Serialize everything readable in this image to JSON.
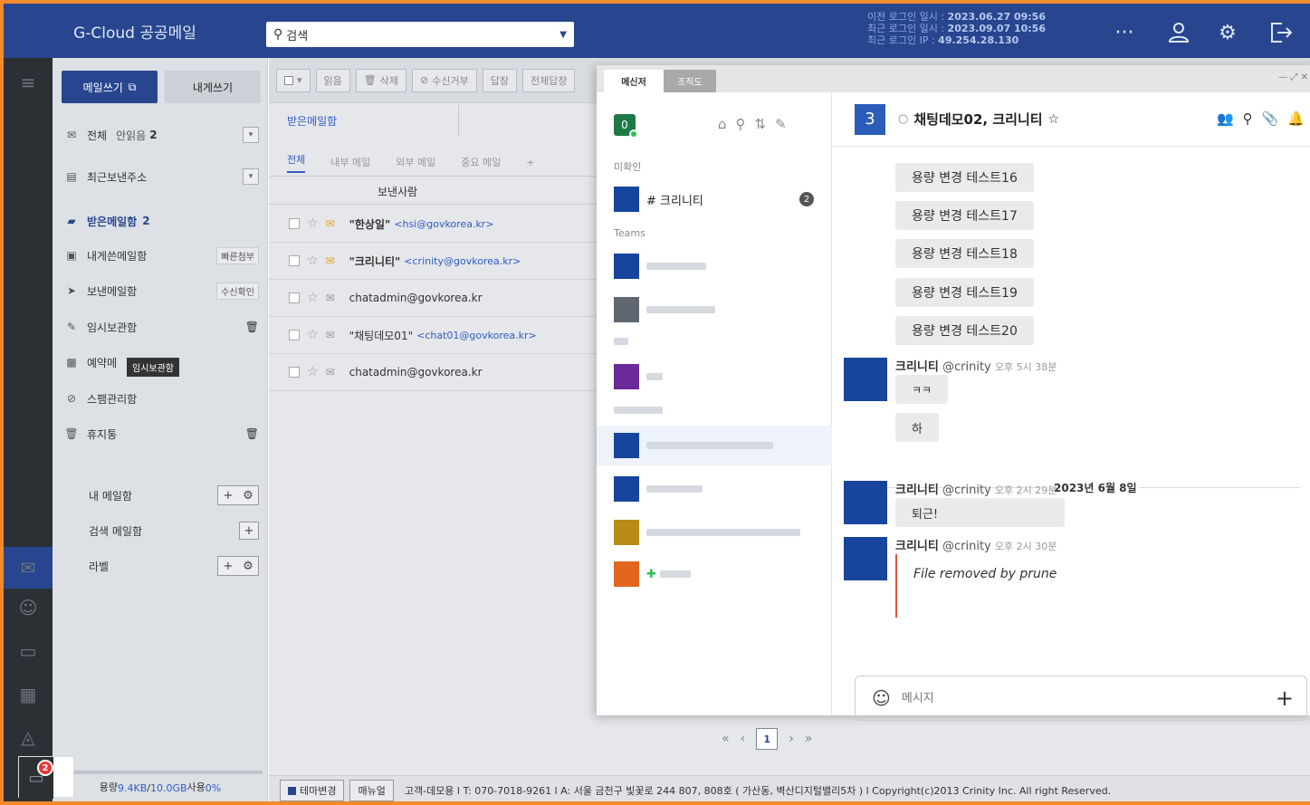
{
  "header": {
    "app_title": "G-Cloud 공공메일",
    "search_value": "검색",
    "login_prev_label": "이전 로그인 일시 : ",
    "login_prev_value": "2023.06.27 09:56",
    "login_last_label": "최근 로그인 일시 : ",
    "login_last_value": "2023.09.07 10:56",
    "login_ip_label": "최근 로그인 IP : ",
    "login_ip_value": "49.254.28.130",
    "icons": [
      "more-icon",
      "user-icon",
      "settings-icon",
      "logout-icon"
    ]
  },
  "sidebar": {
    "write_label": "메일쓰기",
    "self_write_label": "내게쓰기",
    "all_label": "전체",
    "unread_label": "안읽음",
    "unread_count": "2",
    "recent_label": "최근보낸주소",
    "inbox_label": "받은메일함",
    "inbox_count": "2",
    "self_box_label": "내게쓴메일함",
    "self_box_tag": "빠른첨부",
    "sent_label": "보낸메일함",
    "sent_tag": "수신확인",
    "draft_label": "임시보관함",
    "reserve_label": "예약메",
    "tooltip": "임시보관함",
    "spam_label": "스팸관리함",
    "trash_label": "휴지통",
    "my_box_label": "내 메일함",
    "search_box_label": "검색 메일함",
    "label_label": "라벨",
    "quota_prefix": "용량 ",
    "quota_used": "9.4KB",
    "quota_sep": " / ",
    "quota_total": "10.0GB",
    "quota_suffix": " 사용 ",
    "quota_pct": "0%",
    "chat_badge": "2"
  },
  "mail": {
    "toolbar": {
      "read": "읽음",
      "delete": "삭제",
      "reject": "수신거부",
      "reply": "답장",
      "reply_all": "전체답장"
    },
    "folder_tab": "받은메일함",
    "subtabs": [
      "전체",
      "내부 메일",
      "외부 메일",
      "중요 메일"
    ],
    "subtab_add": "+",
    "col_sender": "보낸사람",
    "rows": [
      {
        "name": "\"한상일\"",
        "addr": "<hsi@govkorea.kr>",
        "unread": true
      },
      {
        "name": "\"크리니티\"",
        "addr": "<crinity@govkorea.kr>",
        "unread": true
      },
      {
        "name": "chatadmin@govkorea.kr",
        "addr": "",
        "unread": false
      },
      {
        "name": "\"채팅데모01\"",
        "addr": "<chat01@govkorea.kr>",
        "unread": false
      },
      {
        "name": "chatadmin@govkorea.kr",
        "addr": "",
        "unread": false
      }
    ],
    "pager": {
      "first": "«",
      "prev": "‹",
      "current": "1",
      "next": "›",
      "last": "»"
    },
    "footer": {
      "theme_btn": "테마변경",
      "manual_btn": "매뉴얼",
      "text": "고객-데모용 l T: 070-7018-9261 l A: 서울 금천구 빛꽃로 244 807, 808호 ( 가산동, 벽산디지털밸리5차 ) l Copyright(c)2013 Crinity Inc. All right Reserved."
    }
  },
  "messenger": {
    "tab_messenger": "메신저",
    "tab_org": "조직도",
    "win_controls": "— ⤢ ✕",
    "my_status_count": "0",
    "section_unread": "미확인",
    "section_teams": "Teams",
    "unread_channel": "# 크리니티",
    "unread_channel_count": "2",
    "room_number": "3",
    "room_title": "채팅데모02, 크리니티",
    "bubbles": [
      "용량 변경 테스트16",
      "용량 변경 테스트17",
      "용량 변경 테스트18",
      "용량 변경 테스트19",
      "용량 변경 테스트20"
    ],
    "msg1_name": "크리니티",
    "msg1_handle": "@crinity",
    "msg1_time": "오후 5시 38분",
    "msg1_text1": "ㅋㅋ",
    "msg1_text2": "하",
    "date_divider": "2023년 6월 8일",
    "msg2_name": "크리니티",
    "msg2_handle": "@crinity",
    "msg2_time": "오후 2시 29분",
    "msg2_text": "퇴근!",
    "msg3_name": "크리니티",
    "msg3_handle": "@crinity",
    "msg3_time": "오후 2시 30분",
    "msg3_text": "File removed by prune",
    "input_placeholder": "메시지",
    "colors": {
      "accent": "#2b5cb8",
      "avatar": "#17459d",
      "online": "#2fbf5a",
      "removed_bar": "#e0533a"
    }
  }
}
